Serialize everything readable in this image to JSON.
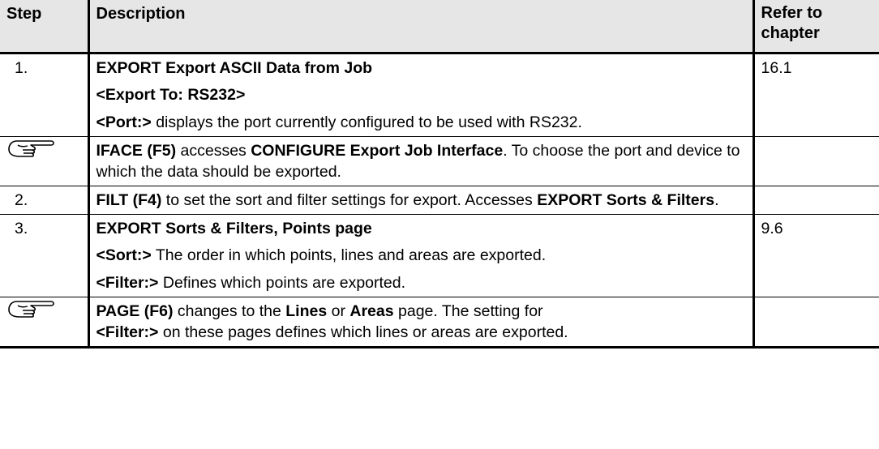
{
  "table": {
    "headers": {
      "step": "Step",
      "description": "Description",
      "refer_to_chapter": "Refer to chapter"
    },
    "rows": [
      {
        "step": "1.",
        "lines": [
          {
            "bold": "EXPORT Export ASCII Data from Job",
            "text": ""
          },
          {
            "bold": "<Export To: RS232>",
            "text": ""
          },
          {
            "bold": "<Port:>",
            "text": " displays the port currently configured to be used with RS232."
          }
        ],
        "chapter": "16.1"
      },
      {
        "step_icon": "pointing-hand-icon",
        "segments": [
          {
            "bold": "IFACE (F5)",
            "text": " accesses "
          },
          {
            "bold": "CONFIGURE Export Job Interface",
            "text": ". To choose the port and device to which the data should be exported."
          }
        ],
        "chapter": ""
      },
      {
        "step": "2.",
        "segments": [
          {
            "bold": "FILT (F4)",
            "text": " to set the sort and filter settings for export. Accesses "
          },
          {
            "bold": "EXPORT Sorts & Filters",
            "text": "."
          }
        ],
        "chapter": ""
      },
      {
        "step": "3.",
        "lines": [
          {
            "bold": "EXPORT Sorts & Filters, Points page",
            "text": ""
          },
          {
            "bold": "<Sort:>",
            "text": " The order in which points, lines and areas are exported."
          },
          {
            "bold": "<Filter:>",
            "text": " Defines which points are exported."
          }
        ],
        "chapter": "9.6"
      },
      {
        "step_icon": "pointing-hand-icon",
        "segments": [
          {
            "bold": "PAGE (F6)",
            "text": " changes to the "
          },
          {
            "bold": "Lines",
            "text": " or "
          },
          {
            "bold": "Areas",
            "text": " page. The setting for "
          },
          {
            "bold": "<Filter:>",
            "text": " on these pages defines which lines or areas are exported."
          }
        ],
        "chapter": ""
      }
    ]
  }
}
